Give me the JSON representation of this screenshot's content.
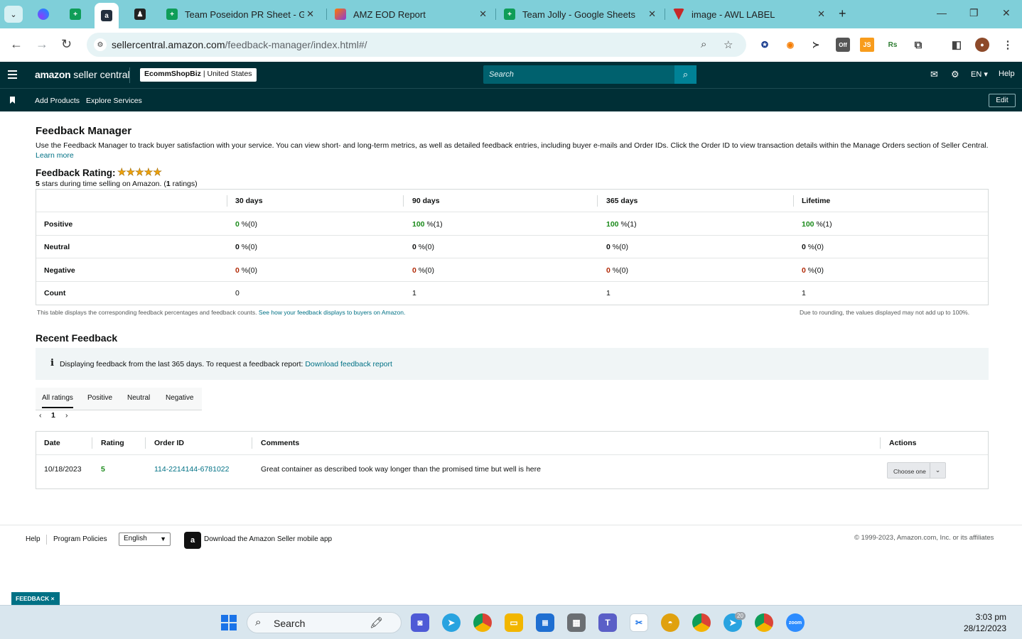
{
  "browser": {
    "tabs": [
      {
        "title": "Team Poseidon PR Sheet - Goo",
        "icon": "sheets-icon"
      },
      {
        "title": "AMZ EOD Report",
        "icon": "amz-icon"
      },
      {
        "title": "Team Jolly - Google Sheets",
        "icon": "sheets-icon"
      },
      {
        "title": "image - AWL LABEL",
        "icon": "awl-icon"
      }
    ],
    "url_host": "sellercentral.amazon.com",
    "url_path": "/feedback-manager/index.html#/"
  },
  "header": {
    "brand": "amazon",
    "brand_suffix": "seller central",
    "store_name": "EcommShopBiz",
    "store_region": "United States",
    "search_placeholder": "Search",
    "language": "EN ▾",
    "help": "Help"
  },
  "subnav": {
    "links": [
      "Add Products",
      "Explore Services"
    ],
    "edit": "Edit"
  },
  "page": {
    "title": "Feedback Manager",
    "intro": "Use the Feedback Manager to track buyer satisfaction with your service. You can view short- and long-term metrics, as well as detailed feedback entries, including buyer e-mails and Order IDs. Click the Order ID to view transaction details within the Manage Orders section of Seller Central.",
    "learn_more": "Learn more",
    "rating_title": "Feedback Rating:",
    "stars": "★★★★★",
    "rating_stars": "5",
    "rating_sub_mid": "stars during time selling on Amazon. (",
    "rating_count": "1",
    "rating_sub_end": "ratings)"
  },
  "rating_table": {
    "columns": [
      "30 days",
      "90 days",
      "365 days",
      "Lifetime"
    ],
    "rows": [
      {
        "label": "Positive",
        "cells": [
          {
            "v": "0",
            "s": "%(0)"
          },
          {
            "v": "100",
            "s": "%(1)"
          },
          {
            "v": "100",
            "s": "%(1)"
          },
          {
            "v": "100",
            "s": "%(1)"
          }
        ]
      },
      {
        "label": "Neutral",
        "cells": [
          {
            "v": "0",
            "s": "%(0)"
          },
          {
            "v": "0",
            "s": "%(0)"
          },
          {
            "v": "0",
            "s": "%(0)"
          },
          {
            "v": "0",
            "s": "%(0)"
          }
        ]
      },
      {
        "label": "Negative",
        "cells": [
          {
            "v": "0",
            "s": "%(0)"
          },
          {
            "v": "0",
            "s": "%(0)"
          },
          {
            "v": "0",
            "s": "%(0)"
          },
          {
            "v": "0",
            "s": "%(0)"
          }
        ]
      },
      {
        "label": "Count",
        "cells": [
          {
            "v": "0",
            "s": ""
          },
          {
            "v": "1",
            "s": ""
          },
          {
            "v": "1",
            "s": ""
          },
          {
            "v": "1",
            "s": ""
          }
        ]
      }
    ],
    "note_left": "This table displays the corresponding feedback percentages and feedback counts.",
    "note_left_link": "See how your feedback displays to buyers on Amazon.",
    "note_right": "Due to rounding, the values displayed may not add up to 100%."
  },
  "recent": {
    "title": "Recent Feedback",
    "info": "Displaying feedback from the last 365 days. To request a feedback report:",
    "info_link": "Download feedback report",
    "tabs": [
      "All ratings",
      "Positive",
      "Neutral",
      "Negative"
    ],
    "page": "1",
    "columns": [
      "Date",
      "Rating",
      "Order ID",
      "Comments",
      "Actions"
    ],
    "rows": [
      {
        "date": "10/18/2023",
        "rating": "5",
        "order_id": "114-2214144-6781022",
        "comment": "Great container as described took way longer than the promised time but well is here",
        "action": "Choose one"
      }
    ]
  },
  "footer": {
    "help": "Help",
    "policies": "Program Policies",
    "language": "English",
    "app_text": "Download the Amazon Seller mobile app",
    "copyright": "© 1999-2023, Amazon.com, Inc. or its affiliates"
  },
  "feedback_tag": "FEEDBACK ×",
  "taskbar": {
    "search": "Search",
    "time": "3:03 pm",
    "date": "28/12/2023",
    "telegram_badge": "20"
  },
  "colors": {
    "header_bg": "#002f36",
    "link": "#007185",
    "positive": "#1a8a1a",
    "negative": "#b12704",
    "tabbar": "#7fcfd9"
  }
}
